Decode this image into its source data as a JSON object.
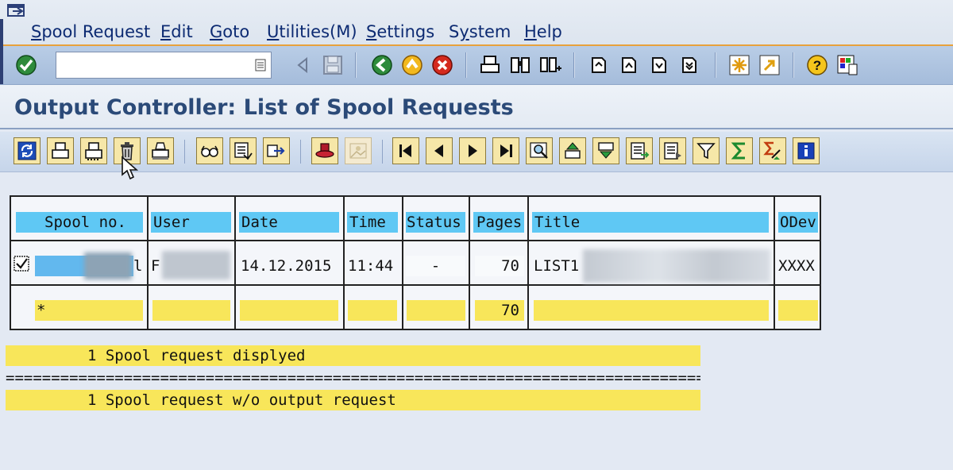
{
  "menu": {
    "items": [
      {
        "label": "Spool Request",
        "underline": "S"
      },
      {
        "label": "Edit",
        "underline": "E"
      },
      {
        "label": "Goto",
        "underline": "G"
      },
      {
        "label": "Utilities(M)",
        "underline": "U"
      },
      {
        "label": "Settings",
        "underline": "S"
      },
      {
        "label": "System",
        "underline": "y"
      },
      {
        "label": "Help",
        "underline": "H"
      }
    ]
  },
  "toolbar": {
    "command_value": "",
    "command_placeholder": ""
  },
  "title": "Output Controller: List of Spool Requests",
  "list": {
    "headers": [
      "Spool no.",
      "User",
      "Date",
      "Time",
      "Status",
      "Pages",
      "Title",
      "ODev"
    ],
    "row": {
      "spool_no_suffix": "l",
      "user_prefix": "F",
      "date": "14.12.2015",
      "time": "11:44",
      "status": "-",
      "pages": "70",
      "title_prefix": "LIST1",
      "odev": "XXXX"
    },
    "totals": {
      "marker": "*",
      "pages": "70"
    }
  },
  "footer": {
    "line1": "         1 Spool request displyed",
    "separator": "===================================================================================",
    "line2": "         1 Spool request w/o output request"
  },
  "colors": {
    "header_cell": "#5fc8f4",
    "total_cell": "#f8e65a",
    "title_text": "#2b4a78"
  }
}
